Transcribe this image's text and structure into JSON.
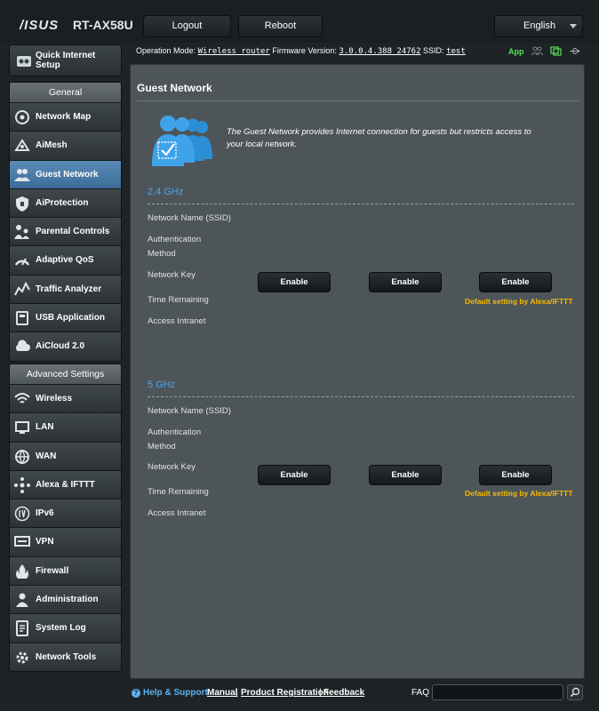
{
  "header": {
    "logo": "/ISUS",
    "model": "RT-AX58U",
    "logout_label": "Logout",
    "reboot_label": "Reboot",
    "language": "English",
    "op_mode_label": "Operation Mode:",
    "op_mode_value": "Wireless router",
    "firmware_label": "Firmware Version:",
    "firmware_value": "3.0.0.4.388_24762",
    "ssid_label": "SSID:",
    "ssid_value": "test",
    "app_label": "App"
  },
  "sidebar": {
    "quick_setup": "Quick Internet Setup",
    "general_title": "General",
    "general_items": [
      {
        "label": "Network Map",
        "icon": "network-map-icon"
      },
      {
        "label": "AiMesh",
        "icon": "aimesh-icon"
      },
      {
        "label": "Guest Network",
        "icon": "guest-network-icon"
      },
      {
        "label": "AiProtection",
        "icon": "aiprotection-icon"
      },
      {
        "label": "Parental Controls",
        "icon": "parental-controls-icon"
      },
      {
        "label": "Adaptive QoS",
        "icon": "adaptive-qos-icon"
      },
      {
        "label": "Traffic Analyzer",
        "icon": "traffic-analyzer-icon"
      },
      {
        "label": "USB Application",
        "icon": "usb-application-icon"
      },
      {
        "label": "AiCloud 2.0",
        "icon": "aicloud-icon"
      }
    ],
    "advanced_title": "Advanced Settings",
    "advanced_items": [
      {
        "label": "Wireless",
        "icon": "wireless-icon"
      },
      {
        "label": "LAN",
        "icon": "lan-icon"
      },
      {
        "label": "WAN",
        "icon": "wan-icon"
      },
      {
        "label": "Alexa & IFTTT",
        "icon": "alexa-icon"
      },
      {
        "label": "IPv6",
        "icon": "ipv6-icon"
      },
      {
        "label": "VPN",
        "icon": "vpn-icon"
      },
      {
        "label": "Firewall",
        "icon": "firewall-icon"
      },
      {
        "label": "Administration",
        "icon": "administration-icon"
      },
      {
        "label": "System Log",
        "icon": "system-log-icon"
      },
      {
        "label": "Network Tools",
        "icon": "network-tools-icon"
      }
    ],
    "active_item": "Guest Network"
  },
  "main": {
    "title": "Guest Network",
    "intro": "The Guest Network provides Internet connection for guests but restricts access to your local network.",
    "bands": [
      {
        "name": "2.4 GHz",
        "labels": [
          "Network Name (SSID)",
          "Authentication Method",
          "Network Key",
          "Time Remaining",
          "Access Intranet"
        ],
        "buttons": [
          "Enable",
          "Enable",
          "Enable"
        ],
        "note": "Default setting by Alexa/IFTTT"
      },
      {
        "name": "5 GHz",
        "labels": [
          "Network Name (SSID)",
          "Authentication Method",
          "Network Key",
          "Time Remaining",
          "Access Intranet"
        ],
        "buttons": [
          "Enable",
          "Enable",
          "Enable"
        ],
        "note": "Default setting by Alexa/IFTTT"
      }
    ]
  },
  "footer": {
    "help": "Help & Support",
    "manual": "Manual",
    "registration": "Product Registration",
    "feedback": "Feedback",
    "faq": "FAQ",
    "separator": "|"
  },
  "colors": {
    "accent_blue": "#49a8ee",
    "active_item": "#4a7aa7",
    "note_yellow": "#f7b900",
    "app_green": "#5be15b"
  }
}
